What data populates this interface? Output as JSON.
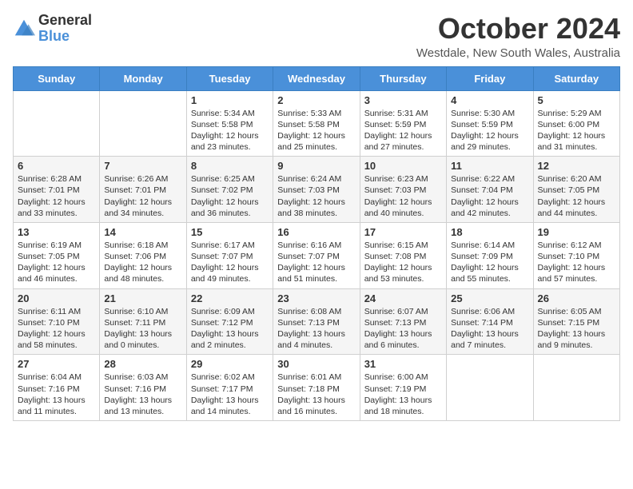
{
  "header": {
    "logo_general": "General",
    "logo_blue": "Blue",
    "month_title": "October 2024",
    "subtitle": "Westdale, New South Wales, Australia"
  },
  "days_of_week": [
    "Sunday",
    "Monday",
    "Tuesday",
    "Wednesday",
    "Thursday",
    "Friday",
    "Saturday"
  ],
  "weeks": [
    [
      {
        "num": "",
        "info": ""
      },
      {
        "num": "",
        "info": ""
      },
      {
        "num": "1",
        "info": "Sunrise: 5:34 AM\nSunset: 5:58 PM\nDaylight: 12 hours and 23 minutes."
      },
      {
        "num": "2",
        "info": "Sunrise: 5:33 AM\nSunset: 5:58 PM\nDaylight: 12 hours and 25 minutes."
      },
      {
        "num": "3",
        "info": "Sunrise: 5:31 AM\nSunset: 5:59 PM\nDaylight: 12 hours and 27 minutes."
      },
      {
        "num": "4",
        "info": "Sunrise: 5:30 AM\nSunset: 5:59 PM\nDaylight: 12 hours and 29 minutes."
      },
      {
        "num": "5",
        "info": "Sunrise: 5:29 AM\nSunset: 6:00 PM\nDaylight: 12 hours and 31 minutes."
      }
    ],
    [
      {
        "num": "6",
        "info": "Sunrise: 6:28 AM\nSunset: 7:01 PM\nDaylight: 12 hours and 33 minutes."
      },
      {
        "num": "7",
        "info": "Sunrise: 6:26 AM\nSunset: 7:01 PM\nDaylight: 12 hours and 34 minutes."
      },
      {
        "num": "8",
        "info": "Sunrise: 6:25 AM\nSunset: 7:02 PM\nDaylight: 12 hours and 36 minutes."
      },
      {
        "num": "9",
        "info": "Sunrise: 6:24 AM\nSunset: 7:03 PM\nDaylight: 12 hours and 38 minutes."
      },
      {
        "num": "10",
        "info": "Sunrise: 6:23 AM\nSunset: 7:03 PM\nDaylight: 12 hours and 40 minutes."
      },
      {
        "num": "11",
        "info": "Sunrise: 6:22 AM\nSunset: 7:04 PM\nDaylight: 12 hours and 42 minutes."
      },
      {
        "num": "12",
        "info": "Sunrise: 6:20 AM\nSunset: 7:05 PM\nDaylight: 12 hours and 44 minutes."
      }
    ],
    [
      {
        "num": "13",
        "info": "Sunrise: 6:19 AM\nSunset: 7:05 PM\nDaylight: 12 hours and 46 minutes."
      },
      {
        "num": "14",
        "info": "Sunrise: 6:18 AM\nSunset: 7:06 PM\nDaylight: 12 hours and 48 minutes."
      },
      {
        "num": "15",
        "info": "Sunrise: 6:17 AM\nSunset: 7:07 PM\nDaylight: 12 hours and 49 minutes."
      },
      {
        "num": "16",
        "info": "Sunrise: 6:16 AM\nSunset: 7:07 PM\nDaylight: 12 hours and 51 minutes."
      },
      {
        "num": "17",
        "info": "Sunrise: 6:15 AM\nSunset: 7:08 PM\nDaylight: 12 hours and 53 minutes."
      },
      {
        "num": "18",
        "info": "Sunrise: 6:14 AM\nSunset: 7:09 PM\nDaylight: 12 hours and 55 minutes."
      },
      {
        "num": "19",
        "info": "Sunrise: 6:12 AM\nSunset: 7:10 PM\nDaylight: 12 hours and 57 minutes."
      }
    ],
    [
      {
        "num": "20",
        "info": "Sunrise: 6:11 AM\nSunset: 7:10 PM\nDaylight: 12 hours and 58 minutes."
      },
      {
        "num": "21",
        "info": "Sunrise: 6:10 AM\nSunset: 7:11 PM\nDaylight: 13 hours and 0 minutes."
      },
      {
        "num": "22",
        "info": "Sunrise: 6:09 AM\nSunset: 7:12 PM\nDaylight: 13 hours and 2 minutes."
      },
      {
        "num": "23",
        "info": "Sunrise: 6:08 AM\nSunset: 7:13 PM\nDaylight: 13 hours and 4 minutes."
      },
      {
        "num": "24",
        "info": "Sunrise: 6:07 AM\nSunset: 7:13 PM\nDaylight: 13 hours and 6 minutes."
      },
      {
        "num": "25",
        "info": "Sunrise: 6:06 AM\nSunset: 7:14 PM\nDaylight: 13 hours and 7 minutes."
      },
      {
        "num": "26",
        "info": "Sunrise: 6:05 AM\nSunset: 7:15 PM\nDaylight: 13 hours and 9 minutes."
      }
    ],
    [
      {
        "num": "27",
        "info": "Sunrise: 6:04 AM\nSunset: 7:16 PM\nDaylight: 13 hours and 11 minutes."
      },
      {
        "num": "28",
        "info": "Sunrise: 6:03 AM\nSunset: 7:16 PM\nDaylight: 13 hours and 13 minutes."
      },
      {
        "num": "29",
        "info": "Sunrise: 6:02 AM\nSunset: 7:17 PM\nDaylight: 13 hours and 14 minutes."
      },
      {
        "num": "30",
        "info": "Sunrise: 6:01 AM\nSunset: 7:18 PM\nDaylight: 13 hours and 16 minutes."
      },
      {
        "num": "31",
        "info": "Sunrise: 6:00 AM\nSunset: 7:19 PM\nDaylight: 13 hours and 18 minutes."
      },
      {
        "num": "",
        "info": ""
      },
      {
        "num": "",
        "info": ""
      }
    ]
  ]
}
